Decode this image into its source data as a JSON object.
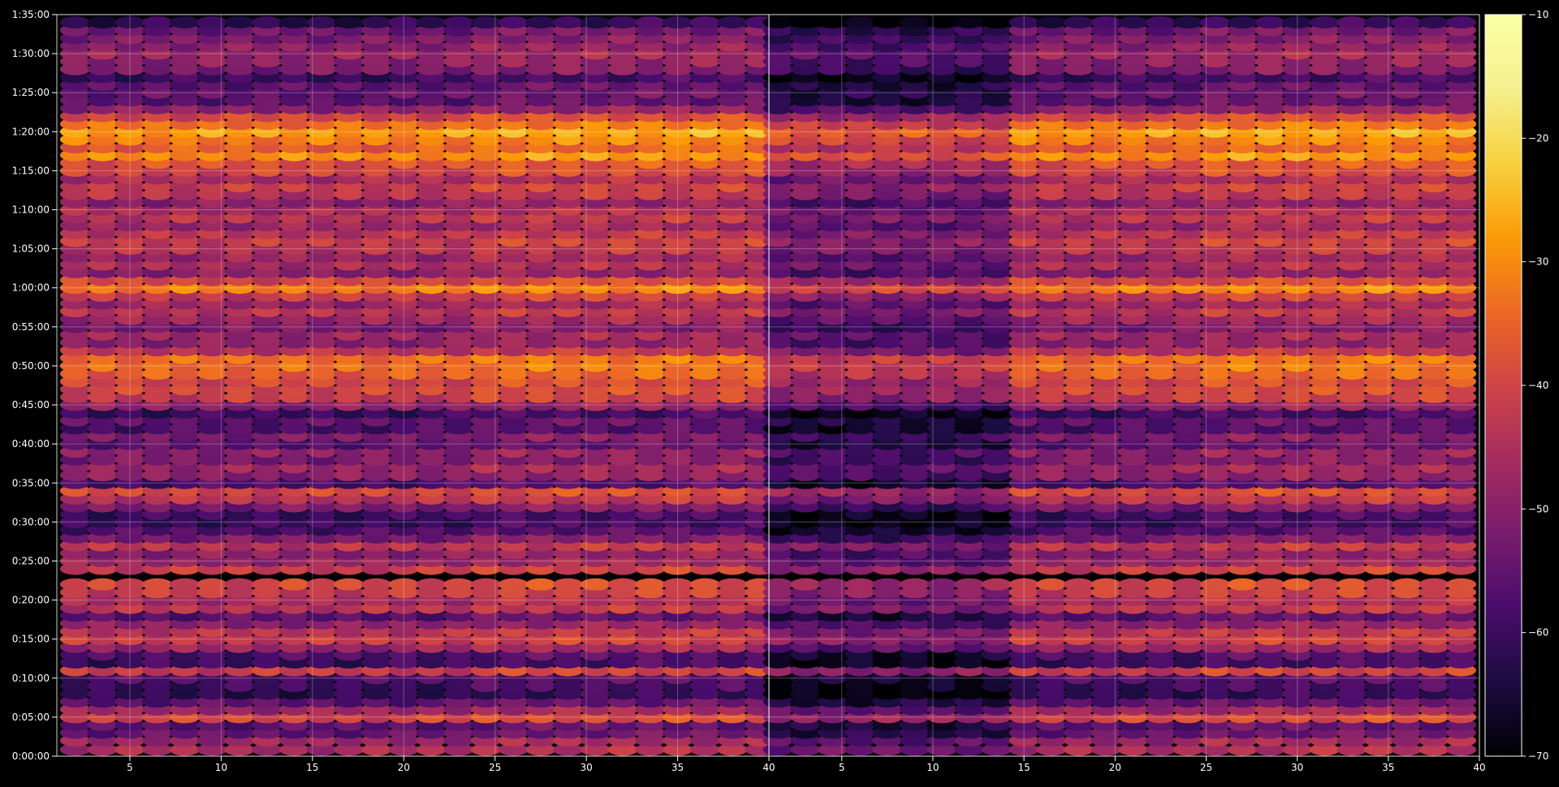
{
  "chart_data": {
    "type": "heatmap",
    "title": "",
    "xlabel": "",
    "ylabel": "",
    "colormap": "inferno",
    "background": "#000000",
    "grid": true,
    "panels": [
      {
        "name": "",
        "xlim": [
          1,
          40
        ],
        "x_ticks": [
          5,
          10,
          15,
          20,
          25,
          30,
          35,
          40
        ],
        "x_tick_labels": [
          "5",
          "10",
          "15",
          "20",
          "25",
          "30",
          "35",
          "40"
        ],
        "columns": {
          "start": 2,
          "end": 39.5,
          "step": 1.5
        }
      },
      {
        "name": "",
        "xlim": [
          1,
          40
        ],
        "x_ticks": [
          5,
          10,
          15,
          20,
          25,
          30,
          35,
          40
        ],
        "x_tick_labels": [
          "5",
          "10",
          "15",
          "20",
          "25",
          "30",
          "35",
          "40"
        ],
        "columns": {
          "start": 1.5,
          "end": 39.5,
          "step": 1.5
        }
      }
    ],
    "y_axis": {
      "unit": "seconds",
      "ylim": [
        0,
        5700
      ],
      "ticks": [
        0,
        300,
        600,
        900,
        1200,
        1500,
        1800,
        2100,
        2400,
        2700,
        3000,
        3300,
        3600,
        3900,
        4200,
        4500,
        4800,
        5100,
        5400,
        5700
      ],
      "tick_labels": [
        "0:00:00",
        "0:05:00",
        "0:10:00",
        "0:15:00",
        "0:20:00",
        "0:25:00",
        "0:30:00",
        "0:35:00",
        "0:40:00",
        "0:45:00",
        "0:50:00",
        "0:55:00",
        "1:00:00",
        "1:05:00",
        "1:10:00",
        "1:15:00",
        "1:20:00",
        "1:25:00",
        "1:30:00",
        "1:35:00"
      ]
    },
    "colorbar": {
      "range": [
        -70,
        -10
      ],
      "ticks": [
        -70,
        -60,
        -50,
        -40,
        -30,
        -20,
        -10
      ],
      "tick_labels": [
        "−70",
        "−60",
        "−50",
        "−40",
        "−30",
        "−20",
        "−10"
      ]
    },
    "bands_seconds_db": [
      [
        50,
        -46
      ],
      [
        120,
        -48
      ],
      [
        180,
        -55
      ],
      [
        240,
        -56
      ],
      [
        300,
        -40
      ],
      [
        360,
        -48
      ],
      [
        420,
        -56
      ],
      [
        480,
        -62
      ],
      [
        540,
        -60
      ],
      [
        600,
        -58
      ],
      [
        660,
        -42
      ],
      [
        720,
        -60
      ],
      [
        780,
        -58
      ],
      [
        840,
        -48
      ],
      [
        900,
        -42
      ],
      [
        960,
        -44
      ],
      [
        1020,
        -50
      ],
      [
        1080,
        -56
      ],
      [
        1140,
        -44
      ],
      [
        1200,
        -46
      ],
      [
        1260,
        -42
      ],
      [
        1320,
        -40
      ],
      [
        1440,
        -42
      ],
      [
        1500,
        -48
      ],
      [
        1560,
        -50
      ],
      [
        1620,
        -44
      ],
      [
        1680,
        -52
      ],
      [
        1740,
        -58
      ],
      [
        1800,
        -60
      ],
      [
        1860,
        -60
      ],
      [
        1920,
        -52
      ],
      [
        1980,
        -44
      ],
      [
        2040,
        -40
      ],
      [
        2100,
        -58
      ],
      [
        2160,
        -50
      ],
      [
        2220,
        -48
      ],
      [
        2280,
        -52
      ],
      [
        2340,
        -50
      ],
      [
        2400,
        -56
      ],
      [
        2460,
        -52
      ],
      [
        2520,
        -58
      ],
      [
        2580,
        -56
      ],
      [
        2640,
        -60
      ],
      [
        2700,
        -50
      ],
      [
        2760,
        -42
      ],
      [
        2820,
        -40
      ],
      [
        2880,
        -40
      ],
      [
        2940,
        -36
      ],
      [
        3000,
        -34
      ],
      [
        3060,
        -34
      ],
      [
        3120,
        -44
      ],
      [
        3180,
        -50
      ],
      [
        3240,
        -48
      ],
      [
        3300,
        -52
      ],
      [
        3360,
        -48
      ],
      [
        3420,
        -44
      ],
      [
        3480,
        -48
      ],
      [
        3540,
        -42
      ],
      [
        3600,
        -32
      ],
      [
        3660,
        -40
      ],
      [
        3720,
        -50
      ],
      [
        3780,
        -46
      ],
      [
        3840,
        -48
      ],
      [
        3900,
        -44
      ],
      [
        3960,
        -42
      ],
      [
        4020,
        -44
      ],
      [
        4080,
        -48
      ],
      [
        4140,
        -44
      ],
      [
        4200,
        -46
      ],
      [
        4260,
        -50
      ],
      [
        4320,
        -44
      ],
      [
        4380,
        -42
      ],
      [
        4440,
        -46
      ],
      [
        4500,
        -40
      ],
      [
        4560,
        -38
      ],
      [
        4620,
        -30
      ],
      [
        4680,
        -36
      ],
      [
        4740,
        -32
      ],
      [
        4800,
        -28
      ],
      [
        4860,
        -34
      ],
      [
        4920,
        -40
      ],
      [
        4980,
        -50
      ],
      [
        5040,
        -56
      ],
      [
        5100,
        -55
      ],
      [
        5160,
        -56
      ],
      [
        5220,
        -60
      ],
      [
        5280,
        -52
      ],
      [
        5340,
        -50
      ],
      [
        5400,
        -48
      ],
      [
        5460,
        -50
      ],
      [
        5520,
        -52
      ],
      [
        5580,
        -54
      ],
      [
        5640,
        -62
      ]
    ]
  }
}
